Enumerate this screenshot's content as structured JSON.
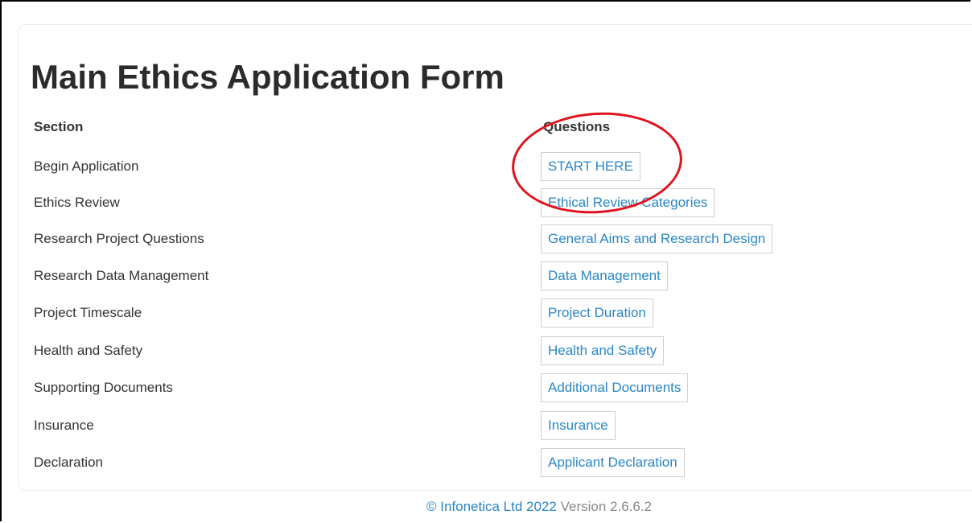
{
  "page": {
    "title": "Main Ethics Application Form"
  },
  "table": {
    "headers": {
      "section": "Section",
      "questions": "Questions"
    },
    "rows": [
      {
        "section": "Begin Application",
        "question": "START HERE"
      },
      {
        "section": "Ethics Review",
        "question": "Ethical Review Categories"
      },
      {
        "section": "Research Project Questions",
        "question": "General Aims and Research Design"
      },
      {
        "section": "Research Data Management",
        "question": "Data Management"
      },
      {
        "section": "Project Timescale",
        "question": "Project Duration"
      },
      {
        "section": "Health and Safety",
        "question": "Health and Safety"
      },
      {
        "section": "Supporting Documents",
        "question": "Additional Documents"
      },
      {
        "section": "Insurance",
        "question": "Insurance"
      },
      {
        "section": "Declaration",
        "question": "Applicant Declaration"
      }
    ]
  },
  "footer": {
    "copyright_link": "© Infonetica Ltd 2022",
    "version": "Version 2.6.6.2"
  },
  "colors": {
    "link": "#2a87c5",
    "annotation": "#e0141e"
  }
}
